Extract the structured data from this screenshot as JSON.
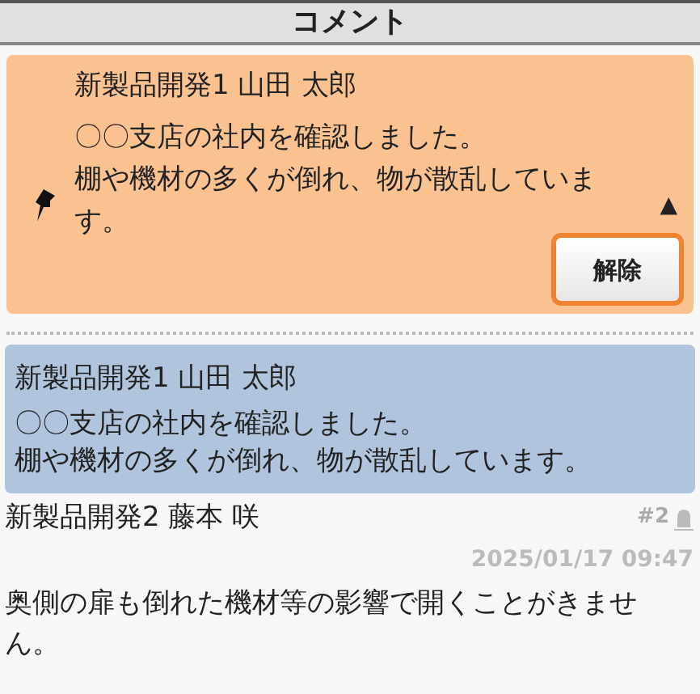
{
  "header": {
    "title": "コメント"
  },
  "pinned": {
    "author": "新製品開発1 山田 太郎",
    "lines": [
      "〇〇支店の社内を確認しました。",
      "棚や機材の多くが倒れ、物が散乱しています。"
    ],
    "toggle": "▲",
    "button": "解除"
  },
  "quote": {
    "author": "新製品開発1 山田 太郎",
    "lines": [
      "〇〇支店の社内を確認しました。",
      "棚や機材の多くが倒れ、物が散乱しています。"
    ]
  },
  "comment": {
    "author": "新製品開発2 藤本 咲",
    "number": "#2",
    "timestamp": "2025/01/17 09:47",
    "text": "奥側の扉も倒れた機材等の影響で開くことがきません。"
  }
}
